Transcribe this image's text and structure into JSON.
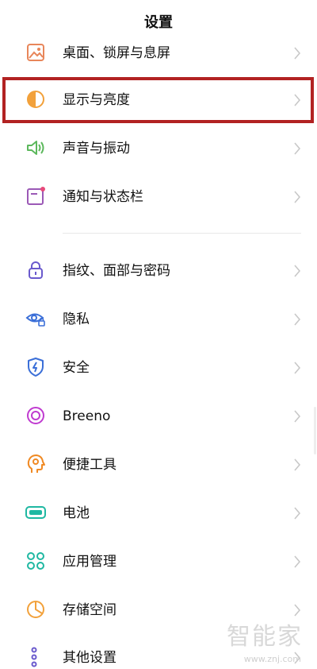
{
  "header": {
    "title": "设置"
  },
  "items": [
    {
      "label": "桌面、锁屏与息屏",
      "icon": "wallpaper-icon"
    },
    {
      "label": "显示与亮度",
      "icon": "brightness-icon"
    },
    {
      "label": "声音与振动",
      "icon": "speaker-icon"
    },
    {
      "label": "通知与状态栏",
      "icon": "notification-icon"
    },
    {
      "label": "指纹、面部与密码",
      "icon": "lock-icon"
    },
    {
      "label": "隐私",
      "icon": "eye-lock-icon"
    },
    {
      "label": "安全",
      "icon": "shield-icon"
    },
    {
      "label": "Breeno",
      "icon": "breeno-icon"
    },
    {
      "label": "便捷工具",
      "icon": "head-gear-icon"
    },
    {
      "label": "电池",
      "icon": "battery-icon"
    },
    {
      "label": "应用管理",
      "icon": "apps-icon"
    },
    {
      "label": "存储空间",
      "icon": "storage-pie-icon"
    },
    {
      "label": "其他设置",
      "icon": "more-settings-icon"
    }
  ],
  "watermark": {
    "main": "智能家",
    "sub": "www.znj.com"
  },
  "colors": {
    "highlight_border": "#b22222",
    "wallpaper": "#e8865a",
    "brightness": "#f2a13b",
    "sound": "#5cb85c",
    "notification": "#9b59b6",
    "lock": "#6a5acd",
    "privacy": "#3b6fd8",
    "security": "#3b6fd8",
    "breeno": "#c03bd0",
    "tools": "#f08a24",
    "battery": "#1fb8a2",
    "apps": "#1fb8a2",
    "storage": "#f2a13b",
    "more": "#6a5acd"
  }
}
